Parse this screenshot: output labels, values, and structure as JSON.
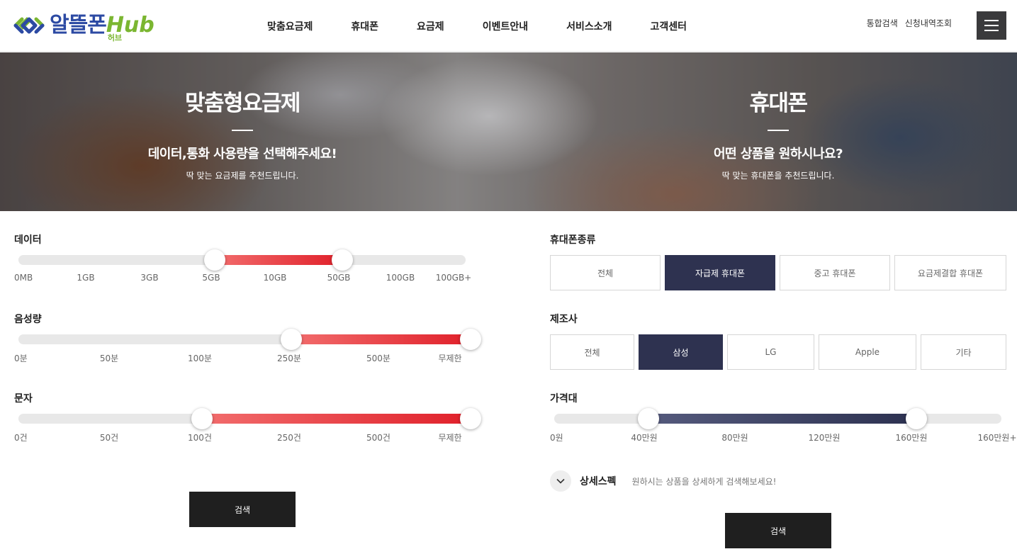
{
  "header": {
    "logo_main": "알뜰폰",
    "logo_hub": "Hub",
    "logo_sub": "허브",
    "nav": [
      "맞춤요금제",
      "휴대폰",
      "요금제",
      "이벤트안내",
      "서비스소개",
      "고객센터"
    ],
    "util": [
      "통합검색",
      "신청내역조회"
    ]
  },
  "hero": {
    "left": {
      "title": "맞춤형요금제",
      "subtitle": "데이터,통화 사용량을 선택해주세요!",
      "desc": "딱 맞는 요금제를 추천드립니다."
    },
    "right": {
      "title": "휴대폰",
      "subtitle": "어떤 상품을 원하시나요?",
      "desc": "딱 맞는 휴대폰을 추천드립니다."
    }
  },
  "plan": {
    "data": {
      "label": "데이터",
      "ticks": [
        "0MB",
        "1GB",
        "3GB",
        "5GB",
        "10GB",
        "50GB",
        "100GB",
        "100GB+"
      ],
      "selected": [
        "5GB",
        "50GB"
      ]
    },
    "voice": {
      "label": "음성량",
      "ticks": [
        "0분",
        "50분",
        "100분",
        "250분",
        "500분",
        "무제한"
      ],
      "selected": [
        "250분",
        "무제한"
      ]
    },
    "sms": {
      "label": "문자",
      "ticks": [
        "0건",
        "50건",
        "100건",
        "250건",
        "500건",
        "무제한"
      ],
      "selected": [
        "100건",
        "무제한"
      ]
    },
    "search_label": "검색"
  },
  "phone": {
    "type": {
      "label": "휴대폰종류",
      "options": [
        "전체",
        "자급제 휴대폰",
        "중고 휴대폰",
        "요금제결합 휴대폰"
      ],
      "selected": "자급제 휴대폰"
    },
    "maker": {
      "label": "제조사",
      "options": [
        "전체",
        "삼성",
        "LG",
        "Apple",
        "기타"
      ],
      "selected": "삼성"
    },
    "price": {
      "label": "가격대",
      "ticks": [
        "0원",
        "40만원",
        "80만원",
        "120만원",
        "160만원",
        "160만원+"
      ],
      "selected": [
        "40만원",
        "160만원"
      ]
    },
    "spec": {
      "title": "상세스펙",
      "desc": "원하시는 상품을 상세하게 검색해보세요!"
    },
    "search_label": "검색"
  },
  "colors": {
    "accent_red": "#e0202a",
    "accent_navy": "#2e3250",
    "logo_blue": "#2c4aa3",
    "logo_green": "#7bb631"
  }
}
